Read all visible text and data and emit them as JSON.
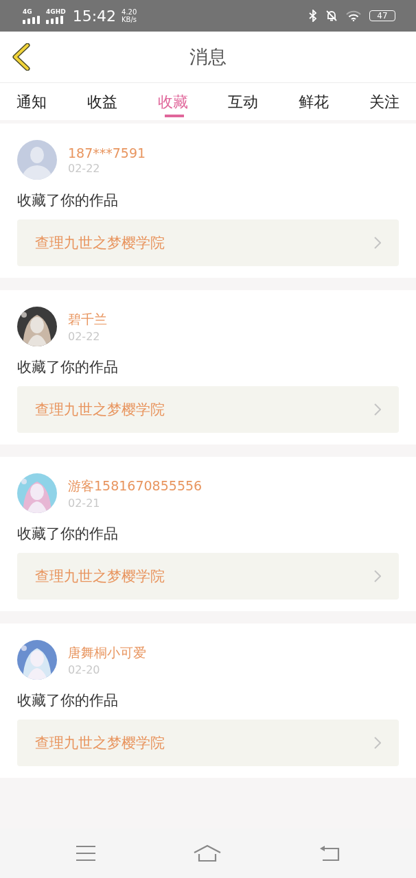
{
  "status_bar": {
    "networks": [
      "4G",
      "4GHD"
    ],
    "time": "15:42",
    "speed": "4.20",
    "speed_unit": "KB/s",
    "battery": "47"
  },
  "header": {
    "title": "消息"
  },
  "tabs": [
    {
      "label": "通知",
      "selected": false
    },
    {
      "label": "收益",
      "selected": false
    },
    {
      "label": "收藏",
      "selected": true
    },
    {
      "label": "互动",
      "selected": false
    },
    {
      "label": "鲜花",
      "selected": false
    },
    {
      "label": "关注",
      "selected": false
    }
  ],
  "messages": [
    {
      "avatar": {
        "kind": "default"
      },
      "name": "187***7591",
      "date": "02-22",
      "action": "收藏了你的作品",
      "work": "查理九世之梦樱学院"
    },
    {
      "name": "碧千兰",
      "date": "02-22",
      "action": "收藏了你的作品",
      "work": "查理九世之梦樱学院"
    },
    {
      "name": "游客1581670855556",
      "date": "02-21",
      "action": "收藏了你的作品",
      "work": "查理九世之梦樱学院"
    },
    {
      "name": "唐舞桐小可爱",
      "date": "02-20",
      "action": "收藏了你的作品",
      "work": "查理九世之梦樱学院"
    }
  ]
}
